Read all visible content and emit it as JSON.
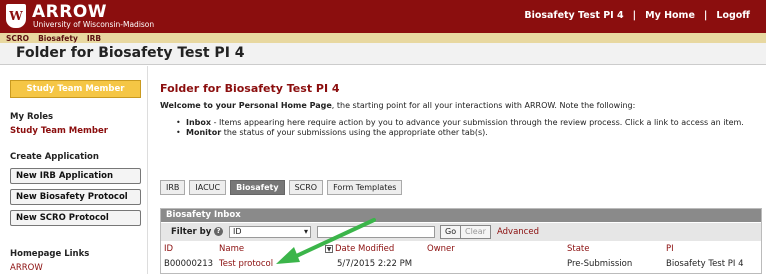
{
  "header": {
    "app_title": "ARROW",
    "app_subtitle": "University of Wisconsin-Madison",
    "user_name": "Biosafety Test PI 4",
    "my_home": "My Home",
    "logoff": "Logoff",
    "sep1": "|",
    "sep2": "|"
  },
  "subnav": [
    "SCRO",
    "Biosafety",
    "IRB"
  ],
  "page_title": "Folder for Biosafety Test PI 4",
  "sidebar": {
    "study_team_button": "Study Team Member",
    "my_roles_heading": "My Roles",
    "role_link": "Study Team Member",
    "create_app_heading": "Create Application",
    "buttons": [
      "New IRB Application",
      "New Biosafety Protocol",
      "New SCRO Protocol"
    ],
    "homepage_links_heading": "Homepage Links",
    "homepage_link": "ARROW"
  },
  "main": {
    "heading": "Folder for Biosafety Test PI 4",
    "welcome_bold": "Welcome to your Personal Home Page",
    "welcome_rest": ", the starting point for all your interactions with ARROW.  Note the following:",
    "bullet1_bold": "Inbox",
    "bullet1_rest": " - Items appearing here require action by you to advance your submission through the review process.  Click a link to access an item.",
    "bullet2_bold": "Monitor",
    "bullet2_rest": " the status of your submissions using the appropriate other tab(s)."
  },
  "tabs": [
    "IRB",
    "IACUC",
    "Biosafety",
    "SCRO",
    "Form Templates"
  ],
  "active_tab": "Biosafety",
  "inbox": {
    "title": "Biosafety Inbox",
    "filter_label": "Filter by",
    "help_icon": "?",
    "filter_field": "ID",
    "filter_value": "",
    "go_button": "Go",
    "clear_button": "Clear",
    "advanced_link": "Advanced",
    "columns": [
      "ID",
      "Name",
      "Date Modified",
      "Owner",
      "State",
      "PI"
    ],
    "sort_icon": "▼",
    "rows": [
      {
        "id": "B00000213",
        "name": "Test protocol",
        "date_modified": "5/7/2015 2:22 PM",
        "owner": "",
        "state": "Pre-Submission",
        "pi": "Biosafety Test PI 4"
      }
    ]
  },
  "colors": {
    "brand": "#8b0e0e",
    "subnav_bg": "#e8d8a0",
    "study_team_button_bg": "#f5c645",
    "arrow_annotation": "#3bb54a"
  }
}
